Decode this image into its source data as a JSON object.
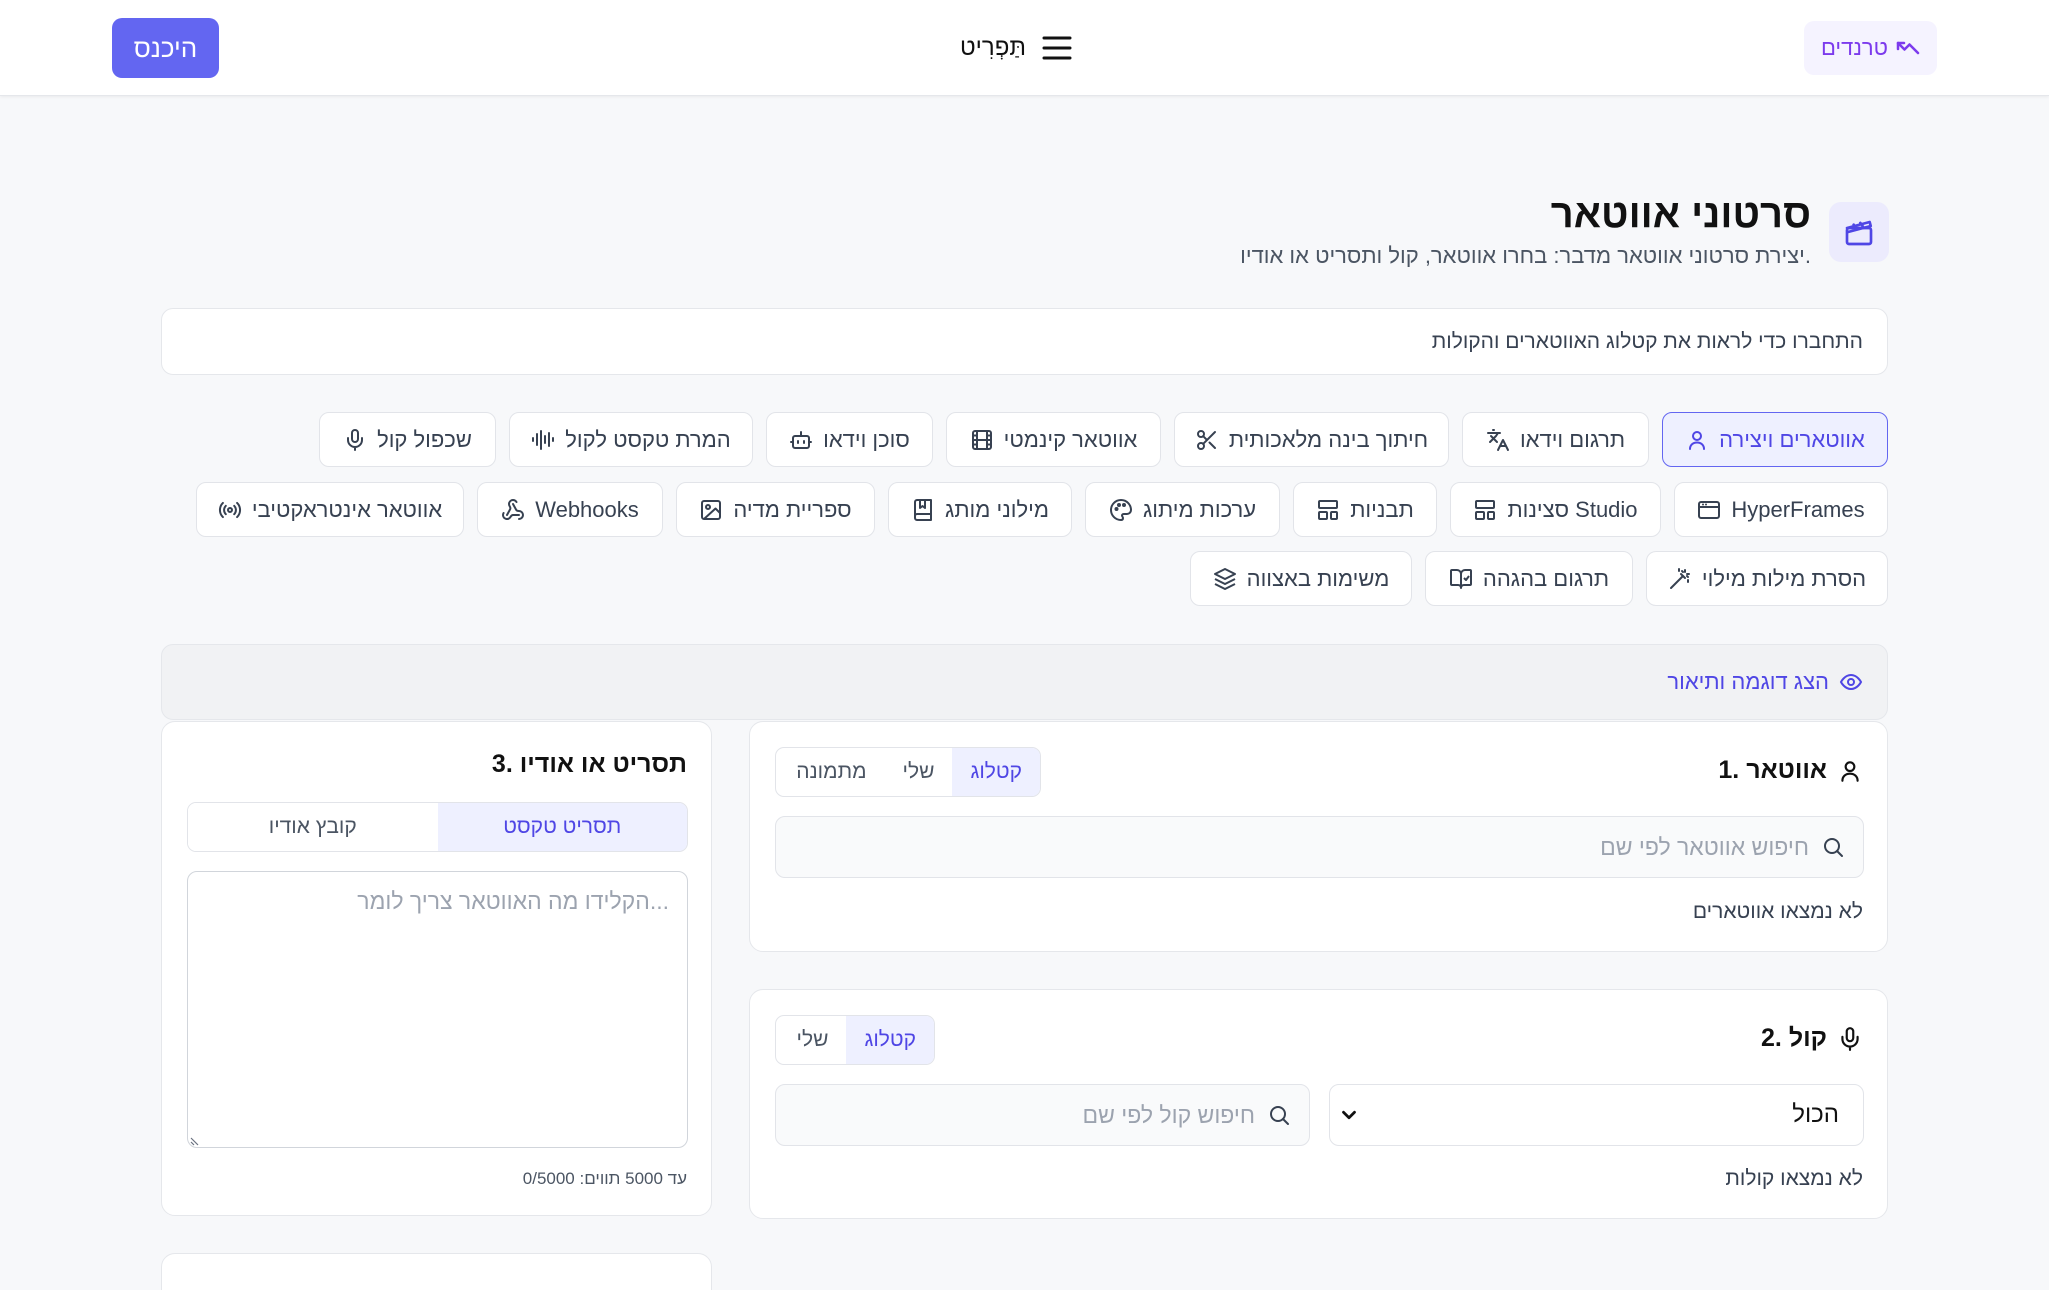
{
  "header": {
    "login_label": "היכנס",
    "menu_label": "תַּפְרִיט",
    "trends_label": "טרנדים"
  },
  "page": {
    "title": "סרטוני אווטאר",
    "subtitle": "יצירת סרטוני אווטאר מדבר: בחרו אווטאר, קול ותסריט או אודיו.",
    "notice": "התחברו כדי לראות את קטלוג האווטארים והקולות"
  },
  "tools": {
    "avatars": "אווטארים ויצירה",
    "translate": "תרגום וידאו",
    "lipsync": "חיתוך בינה מלאכותית",
    "kinetic": "אווטאר קינמטי",
    "agent": "סוכן וידאו",
    "tts": "המרת טקסט לקול",
    "dubbing": "שכפול קול",
    "hyperframes": "HyperFrames",
    "studio": "סצינות Studio",
    "templates": "תבניות",
    "brand": "ערכות מיתוג",
    "glossary": "מילוני מותג",
    "media": "ספריית מדיה",
    "webhooks": "Webhooks",
    "interactive": "אווטאר אינטראקטיבי",
    "fillers": "הסרת מילות מילוי",
    "proof": "תרגום בהגהה",
    "batch": "משימות באצווה"
  },
  "example": {
    "label": "הצג דוגמה ותיאור"
  },
  "avatar_card": {
    "title": "1. אווטאר",
    "tabs": [
      "קטלוג",
      "שלי",
      "מתמונה"
    ],
    "search_placeholder": "חיפוש אווטאר לפי שם",
    "empty": "לא נמצאו אווטארים"
  },
  "voice_card": {
    "title": "2. קול",
    "tabs": [
      "קטלוג",
      "שלי"
    ],
    "select_value": "הכול",
    "search_placeholder": "חיפוש קול לפי שם",
    "empty": "לא נמצאו קולות"
  },
  "script_card": {
    "title": "3. תסריט או אודיו",
    "tabs": [
      "תסריט טקסט",
      "קובץ אודיו"
    ],
    "placeholder": "הקלידו מה האווטאר צריך לומר...",
    "counter": "עד 5000 תווים: 0/5000"
  },
  "colors": {
    "accent": "#6366f1",
    "accent_text": "#4f46e5",
    "trends": "#7c3aed"
  }
}
